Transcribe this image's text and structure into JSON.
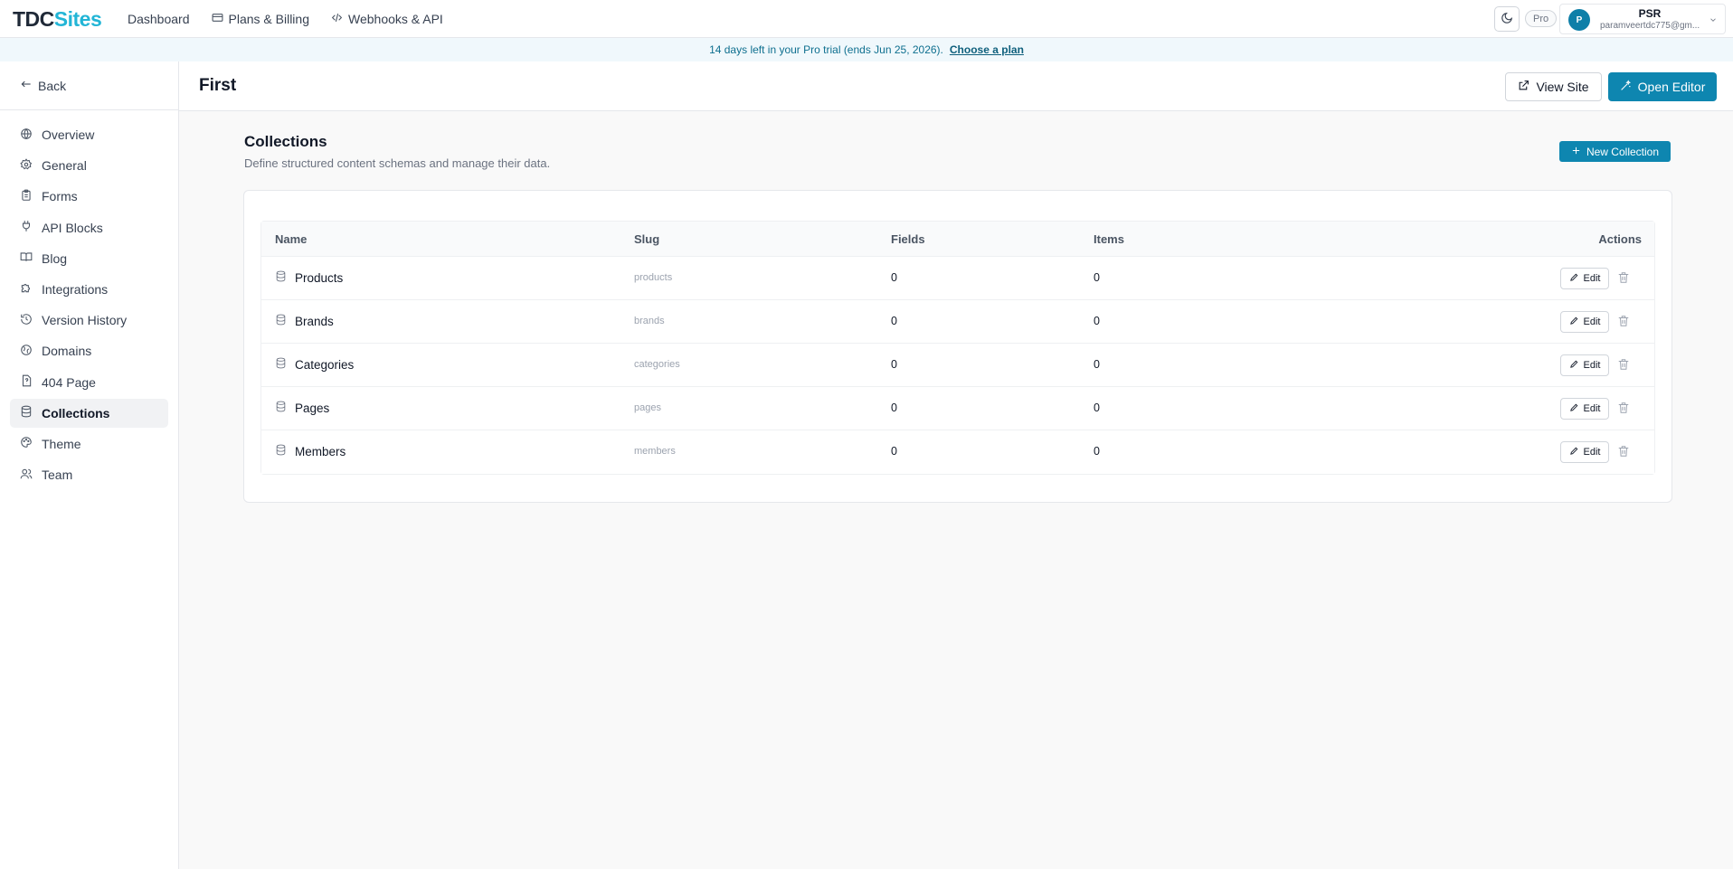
{
  "topbar": {
    "logo_part1": "TDC",
    "logo_part2": "Sites",
    "nav": [
      {
        "label": "Dashboard",
        "icon": "none"
      },
      {
        "label": "Plans & Billing",
        "icon": "credit-card-icon"
      },
      {
        "label": "Webhooks & API",
        "icon": "code-icon"
      }
    ],
    "plan_badge": "Pro",
    "user": {
      "initial": "P",
      "name": "PSR",
      "email": "paramveertdc775@gm..."
    }
  },
  "banner": {
    "text": "14 days left in your Pro trial (ends Jun 25, 2026).",
    "link": "Choose a plan"
  },
  "sidebar": {
    "back_label": "Back",
    "items": [
      {
        "label": "Overview",
        "icon": "globe-icon",
        "active": false
      },
      {
        "label": "General",
        "icon": "gear-icon",
        "active": false
      },
      {
        "label": "Forms",
        "icon": "clipboard-icon",
        "active": false
      },
      {
        "label": "API Blocks",
        "icon": "plug-icon",
        "active": false
      },
      {
        "label": "Blog",
        "icon": "book-icon",
        "active": false
      },
      {
        "label": "Integrations",
        "icon": "puzzle-icon",
        "active": false
      },
      {
        "label": "Version History",
        "icon": "history-icon",
        "active": false
      },
      {
        "label": "Domains",
        "icon": "globe-link-icon",
        "active": false
      },
      {
        "label": "404 Page",
        "icon": "file-question-icon",
        "active": false
      },
      {
        "label": "Collections",
        "icon": "database-icon",
        "active": true
      },
      {
        "label": "Theme",
        "icon": "palette-icon",
        "active": false
      },
      {
        "label": "Team",
        "icon": "users-icon",
        "active": false
      }
    ]
  },
  "header": {
    "title": "First",
    "view_site_label": "View Site",
    "open_editor_label": "Open Editor"
  },
  "collections": {
    "title": "Collections",
    "subtitle": "Define structured content schemas and manage their data.",
    "new_button_label": "New Collection",
    "columns": {
      "name": "Name",
      "slug": "Slug",
      "fields": "Fields",
      "items": "Items",
      "actions": "Actions"
    },
    "edit_label": "Edit",
    "rows": [
      {
        "name": "Products",
        "slug": "products",
        "fields": "0",
        "items": "0"
      },
      {
        "name": "Brands",
        "slug": "brands",
        "fields": "0",
        "items": "0"
      },
      {
        "name": "Categories",
        "slug": "categories",
        "fields": "0",
        "items": "0"
      },
      {
        "name": "Pages",
        "slug": "pages",
        "fields": "0",
        "items": "0"
      },
      {
        "name": "Members",
        "slug": "members",
        "fields": "0",
        "items": "0"
      }
    ]
  },
  "colors": {
    "brand": "#22b5d6",
    "primary": "#0e86b0",
    "banner_bg": "#f0f8fc"
  }
}
